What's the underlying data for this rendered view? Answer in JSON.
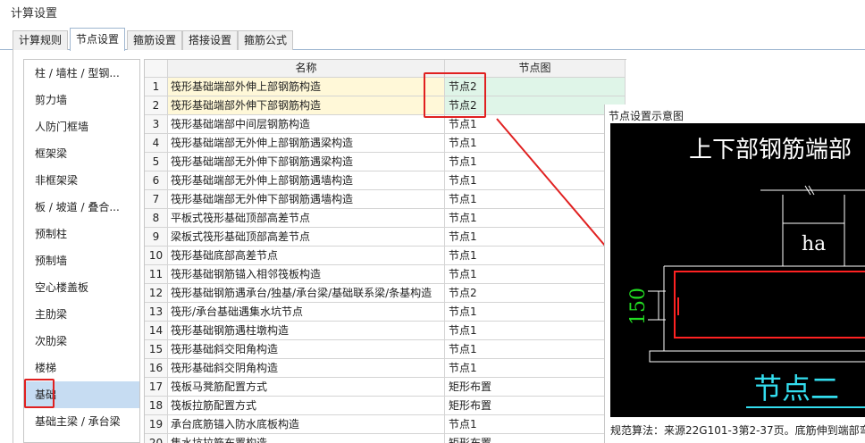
{
  "window": {
    "title": "计算设置"
  },
  "tabs": [
    {
      "label": "计算规则",
      "active": false
    },
    {
      "label": "节点设置",
      "active": true
    },
    {
      "label": "箍筋设置",
      "active": false
    },
    {
      "label": "搭接设置",
      "active": false
    },
    {
      "label": "箍筋公式",
      "active": false
    }
  ],
  "sidebar": {
    "items": [
      {
        "label": "柱 / 墙柱 / 型钢..."
      },
      {
        "label": "剪力墙"
      },
      {
        "label": "人防门框墙"
      },
      {
        "label": "框架梁"
      },
      {
        "label": "非框架梁"
      },
      {
        "label": "板 / 坡道 / 叠合..."
      },
      {
        "label": "预制柱"
      },
      {
        "label": "预制墙"
      },
      {
        "label": "空心楼盖板"
      },
      {
        "label": "主肋梁"
      },
      {
        "label": "次肋梁"
      },
      {
        "label": "楼梯"
      },
      {
        "label": "基础"
      },
      {
        "label": "基础主梁 / 承台梁"
      }
    ],
    "selected": "基础"
  },
  "grid": {
    "headers": {
      "name": "名称",
      "node": "节点图"
    },
    "rows": [
      {
        "num": "1",
        "name": "筏形基础端部外伸上部钢筋构造",
        "node": "节点2"
      },
      {
        "num": "2",
        "name": "筏形基础端部外伸下部钢筋构造",
        "node": "节点2"
      },
      {
        "num": "3",
        "name": "筏形基础端部中间层钢筋构造",
        "node": "节点1"
      },
      {
        "num": "4",
        "name": "筏形基础端部无外伸上部钢筋遇梁构造",
        "node": "节点1"
      },
      {
        "num": "5",
        "name": "筏形基础端部无外伸下部钢筋遇梁构造",
        "node": "节点1"
      },
      {
        "num": "6",
        "name": "筏形基础端部无外伸上部钢筋遇墙构造",
        "node": "节点1"
      },
      {
        "num": "7",
        "name": "筏形基础端部无外伸下部钢筋遇墙构造",
        "node": "节点1"
      },
      {
        "num": "8",
        "name": "平板式筏形基础顶部高差节点",
        "node": "节点1"
      },
      {
        "num": "9",
        "name": "梁板式筏形基础顶部高差节点",
        "node": "节点1"
      },
      {
        "num": "10",
        "name": "筏形基础底部高差节点",
        "node": "节点1"
      },
      {
        "num": "11",
        "name": "筏形基础钢筋锚入相邻筏板构造",
        "node": "节点1"
      },
      {
        "num": "12",
        "name": "筏形基础钢筋遇承台/独基/承台梁/基础联系梁/条基构造",
        "node": "节点2"
      },
      {
        "num": "13",
        "name": "筏形/承台基础遇集水坑节点",
        "node": "节点1"
      },
      {
        "num": "14",
        "name": "筏形基础钢筋遇柱墩构造",
        "node": "节点1"
      },
      {
        "num": "15",
        "name": "筏形基础斜交阳角构造",
        "node": "节点1"
      },
      {
        "num": "16",
        "name": "筏形基础斜交阴角构造",
        "node": "节点1"
      },
      {
        "num": "17",
        "name": "筏板马凳筋配置方式",
        "node": "矩形布置"
      },
      {
        "num": "18",
        "name": "筏板拉筋配置方式",
        "node": "矩形布置"
      },
      {
        "num": "19",
        "name": "承台底筋锚入防水底板构造",
        "node": "节点1"
      },
      {
        "num": "20",
        "name": "集水坑拉筋布置构造",
        "node": "矩形布置"
      }
    ]
  },
  "preview": {
    "title": "节点设置示意图",
    "drawing_title": "上下部钢筋端部",
    "dim_ha": "ha",
    "dim_150": "150",
    "node_label": "节点二",
    "note": "规范算法：来源22G101-3第2-37页。底筋伸到端部弯",
    "colors": {
      "title": "#ffffff",
      "dim_150": "#22dd22",
      "node_label": "#33ddee",
      "rebar": "#ff2222",
      "lines": "#ffffff"
    }
  },
  "annotations": {
    "highlight_color": "#e02020"
  }
}
